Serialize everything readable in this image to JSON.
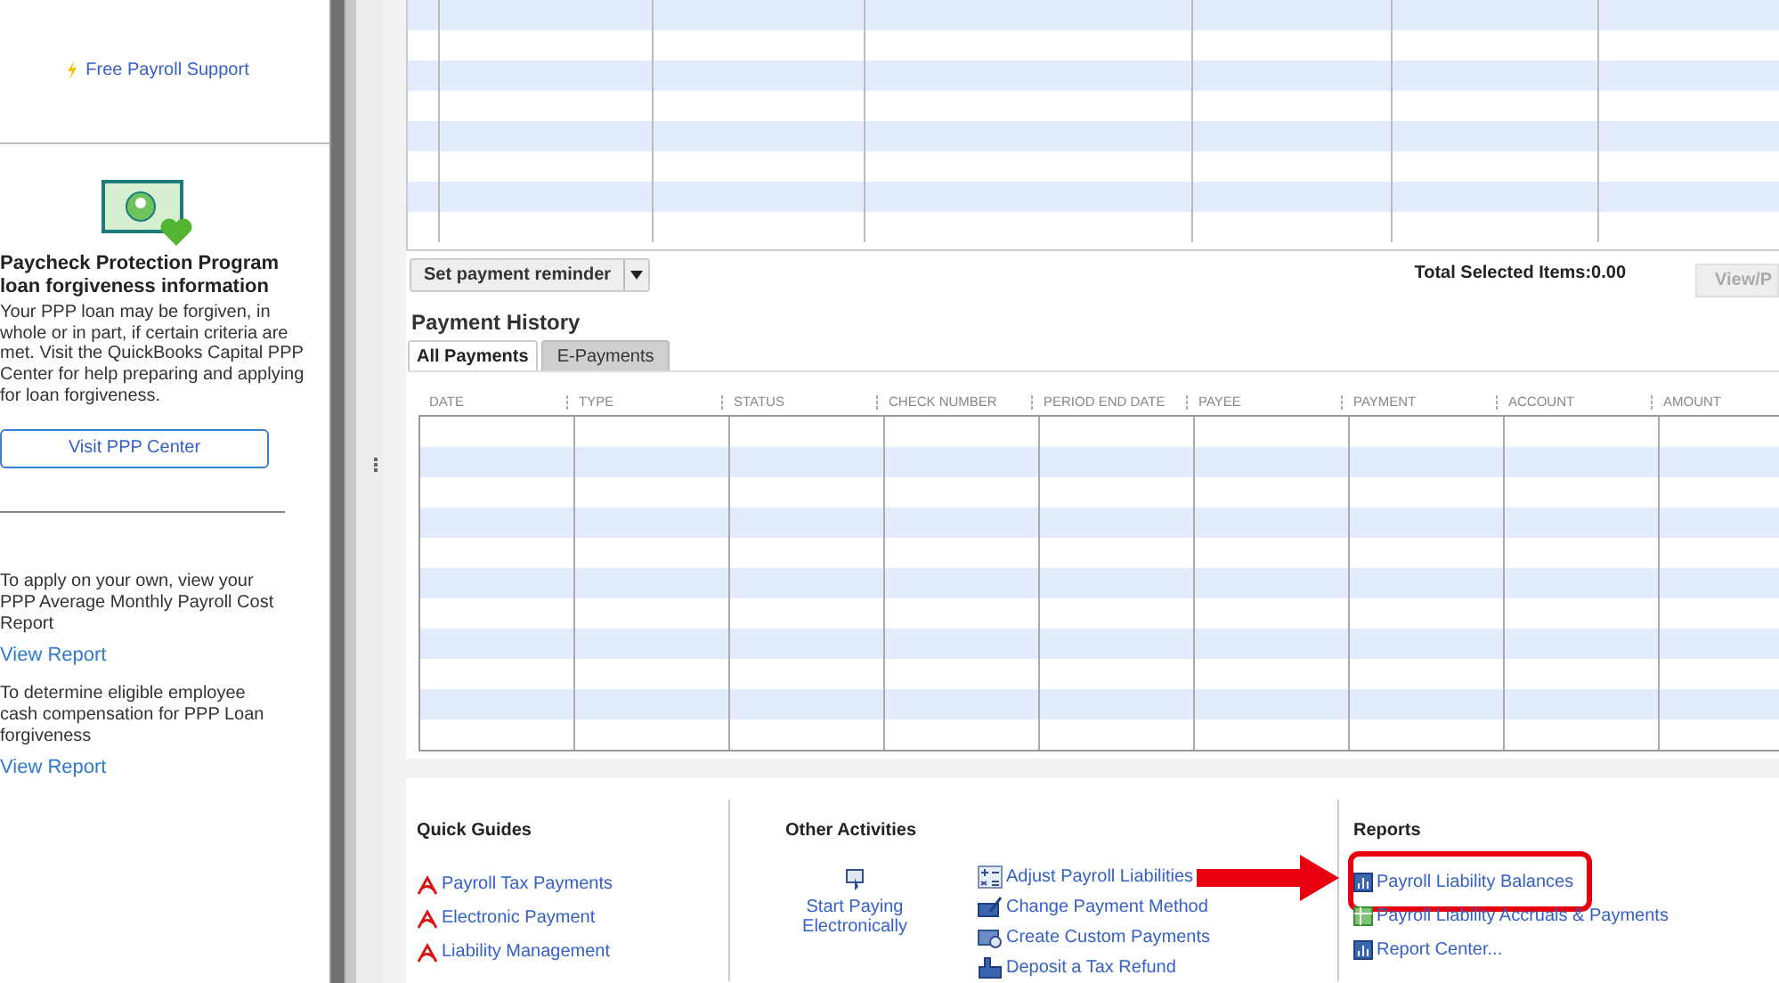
{
  "sidebar": {
    "support_link": "Free Payroll Support",
    "promo": {
      "title": "Paycheck Protection Program loan forgiveness information",
      "body": "Your PPP loan may be forgiven, in whole or in part, if certain criteria are met. Visit the QuickBooks Capital PPP Center for help preparing and applying for loan forgiveness.",
      "button": "Visit PPP Center"
    },
    "report_notes": [
      {
        "text": "To apply on your own, view your PPP Average Monthly Payroll Cost Report",
        "link": "View Report"
      },
      {
        "text": "To determine eligible employee cash compensation for PPP Loan forgiveness",
        "link": "View Report"
      }
    ]
  },
  "reminder_button": {
    "label": "Set payment reminder"
  },
  "total_selected": "Total Selected Items:0.00",
  "view_button": {
    "label": "View/P",
    "disabled": true
  },
  "payment_history": {
    "title": "Payment History",
    "tabs": [
      {
        "label": "All Payments",
        "selected": true
      },
      {
        "label": "E-Payments",
        "selected": false
      }
    ],
    "columns": [
      "DATE",
      "TYPE",
      "STATUS",
      "CHECK NUMBER",
      "PERIOD END DATE",
      "PAYEE",
      "PAYMENT",
      "ACCOUNT",
      "AMOUNT"
    ]
  },
  "quick_guides": {
    "title": "Quick Guides",
    "links": [
      "Payroll Tax Payments",
      "Electronic Payment",
      "Liability Management"
    ]
  },
  "other_activities": {
    "title": "Other Activities",
    "main_action": "Start Paying Electronically",
    "links": [
      {
        "label": "Adjust Payroll Liabilities",
        "kind": "calculator"
      },
      {
        "label": "Change Payment Method",
        "kind": "check"
      },
      {
        "label": "Create Custom Payments",
        "kind": "card"
      },
      {
        "label": "Deposit a Tax Refund",
        "kind": "hand"
      }
    ]
  },
  "reports": {
    "title": "Reports",
    "links": [
      {
        "label": "Payroll Liability Balances",
        "kind": "chart",
        "highlighted": true
      },
      {
        "label": "Payroll Liability Accruals & Payments",
        "kind": "sheet",
        "highlighted": false
      },
      {
        "label": "Report Center...",
        "kind": "chart",
        "highlighted": false
      }
    ]
  }
}
